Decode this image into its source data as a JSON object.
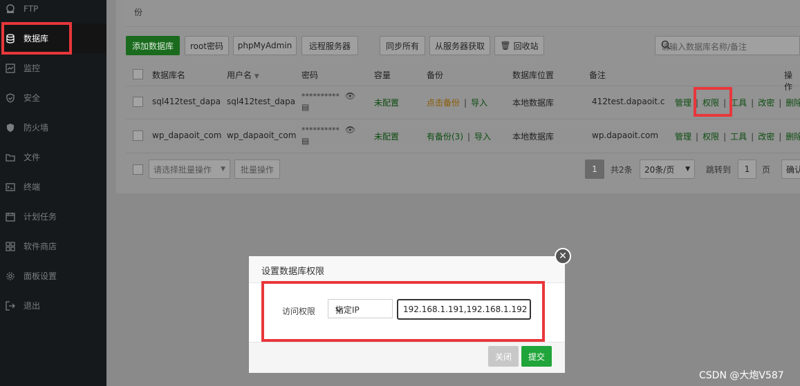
{
  "sidebar": {
    "items": [
      {
        "label": "FTP",
        "icon": "ftp-icon"
      },
      {
        "label": "数据库",
        "icon": "database-icon",
        "active": true
      },
      {
        "label": "监控",
        "icon": "monitor-icon"
      },
      {
        "label": "安全",
        "icon": "shield-icon"
      },
      {
        "label": "防火墙",
        "icon": "firewall-icon"
      },
      {
        "label": "文件",
        "icon": "folder-icon"
      },
      {
        "label": "终端",
        "icon": "terminal-icon"
      },
      {
        "label": "计划任务",
        "icon": "calendar-icon"
      },
      {
        "label": "软件商店",
        "icon": "grid-icon"
      },
      {
        "label": "面板设置",
        "icon": "gear-icon"
      },
      {
        "label": "退出",
        "icon": "logout-icon"
      }
    ]
  },
  "note": {
    "text": "份"
  },
  "toolbar": {
    "add_db": "添加数据库",
    "root_pwd": "root密码",
    "phpmyadmin": "phpMyAdmin",
    "remote": "远程服务器",
    "sync_all": "同步所有",
    "fetch": "从服务器获取",
    "recycle": "回收站",
    "search_placeholder": "请输入数据库名称/备注"
  },
  "table": {
    "headers": {
      "name": "数据库名",
      "user": "用户名",
      "password": "密码",
      "capacity": "容量",
      "backup": "备份",
      "location": "数据库位置",
      "remark": "备注",
      "actions": "操作"
    },
    "rows": [
      {
        "name": "sql412test_dapa",
        "user": "sql412test_dapa",
        "password": "**********",
        "capacity": "未配置",
        "backup": "点击备份",
        "import": "导入",
        "location": "本地数据库",
        "remark": "412test.dapaoit.c",
        "actions": [
          "管理",
          "权限",
          "工具",
          "改密",
          "删除"
        ]
      },
      {
        "name": "wp_dapaoit_com",
        "user": "wp_dapaoit_com",
        "password": "**********",
        "capacity": "未配置",
        "backup": "有备份(3)",
        "import": "导入",
        "location": "本地数据库",
        "remark": "wp.dapaoit.com",
        "actions": [
          "管理",
          "权限",
          "工具",
          "改密",
          "删除"
        ]
      }
    ]
  },
  "footer": {
    "batch_placeholder": "请选择批量操作",
    "batch_button": "批量操作",
    "current_page": "1",
    "total": "共2条",
    "per_page": "20条/页",
    "jump_label": "跳转到",
    "jump_value": "1",
    "page_unit": "页",
    "confirm": "确认"
  },
  "modal": {
    "title": "设置数据库权限",
    "field_label": "访问权限",
    "select_value": "指定IP",
    "ip_value": "192.168.1.191,192.168.1.192",
    "close_button": "关闭",
    "submit_button": "提交"
  },
  "watermark": "CSDN @大炮V587",
  "colors": {
    "highlight": "#e8373b",
    "primary_green": "#20a53a"
  }
}
